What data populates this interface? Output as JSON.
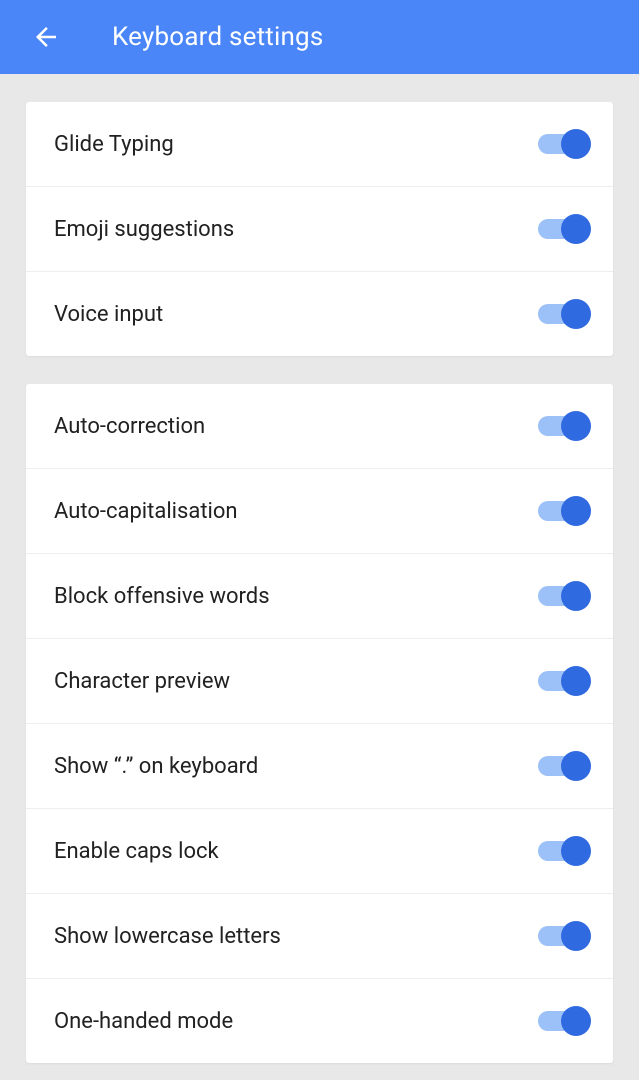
{
  "header": {
    "title": "Keyboard settings"
  },
  "sections": [
    {
      "items": [
        {
          "label": "Glide Typing",
          "on": true
        },
        {
          "label": "Emoji suggestions",
          "on": true
        },
        {
          "label": "Voice input",
          "on": true
        }
      ]
    },
    {
      "items": [
        {
          "label": "Auto-correction",
          "on": true
        },
        {
          "label": "Auto-capitalisation",
          "on": true
        },
        {
          "label": "Block offensive words",
          "on": true
        },
        {
          "label": "Character preview",
          "on": true
        },
        {
          "label": "Show “.” on keyboard",
          "on": true
        },
        {
          "label": "Enable caps lock",
          "on": true
        },
        {
          "label": "Show lowercase letters",
          "on": true
        },
        {
          "label": "One-handed mode",
          "on": true
        }
      ]
    }
  ]
}
